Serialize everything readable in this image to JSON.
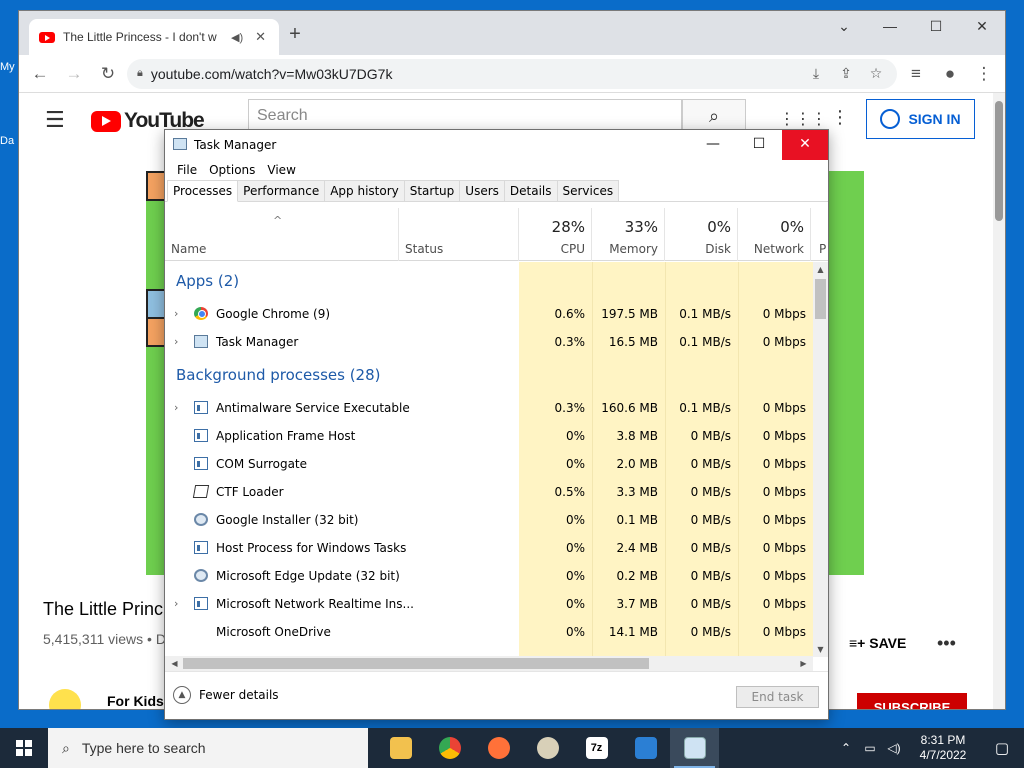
{
  "desktop": {
    "label1": "My",
    "label2": "Da"
  },
  "browser": {
    "tab_title": "The Little Princess - I don't w",
    "url": "youtube.com/watch?v=Mw03kU7DG7k",
    "window_controls": [
      "⌄",
      "—",
      "☐",
      "✕"
    ]
  },
  "youtube": {
    "search_placeholder": "Search",
    "sign_in": "SIGN IN",
    "video_title": "The Little Princ",
    "views": "5,415,311 views • D",
    "save": "SAVE",
    "channel": "For Kids T",
    "subscribe": "SUBSCRIBE"
  },
  "taskmanager": {
    "title": "Task Manager",
    "menu": [
      "File",
      "Options",
      "View"
    ],
    "tabs": [
      "Processes",
      "Performance",
      "App history",
      "Startup",
      "Users",
      "Details",
      "Services"
    ],
    "columns": {
      "name": "Name",
      "status": "Status",
      "cpu": {
        "pct": "28%",
        "label": "CPU"
      },
      "memory": {
        "pct": "33%",
        "label": "Memory"
      },
      "disk": {
        "pct": "0%",
        "label": "Disk"
      },
      "network": {
        "pct": "0%",
        "label": "Network"
      },
      "power": "P"
    },
    "groups": {
      "apps": "Apps (2)",
      "background": "Background processes (28)"
    },
    "apps": [
      {
        "name": "Google Chrome (9)",
        "icon": "chrome-icon",
        "cpu": "0.6%",
        "mem": "197.5 MB",
        "disk": "0.1 MB/s",
        "net": "0 Mbps"
      },
      {
        "name": "Task Manager",
        "icon": "task-manager-icon",
        "cpu": "0.3%",
        "mem": "16.5 MB",
        "disk": "0.1 MB/s",
        "net": "0 Mbps"
      }
    ],
    "background": [
      {
        "name": "Antimalware Service Executable",
        "icon": "window-icon",
        "cpu": "0.3%",
        "mem": "160.6 MB",
        "disk": "0.1 MB/s",
        "net": "0 Mbps"
      },
      {
        "name": "Application Frame Host",
        "icon": "window-icon",
        "cpu": "0%",
        "mem": "3.8 MB",
        "disk": "0 MB/s",
        "net": "0 Mbps"
      },
      {
        "name": "COM Surrogate",
        "icon": "window-icon",
        "cpu": "0%",
        "mem": "2.0 MB",
        "disk": "0 MB/s",
        "net": "0 Mbps"
      },
      {
        "name": "CTF Loader",
        "icon": "pen-icon",
        "cpu": "0.5%",
        "mem": "3.3 MB",
        "disk": "0 MB/s",
        "net": "0 Mbps"
      },
      {
        "name": "Google Installer (32 bit)",
        "icon": "installer-icon",
        "cpu": "0%",
        "mem": "0.1 MB",
        "disk": "0 MB/s",
        "net": "0 Mbps"
      },
      {
        "name": "Host Process for Windows Tasks",
        "icon": "window-icon",
        "cpu": "0%",
        "mem": "2.4 MB",
        "disk": "0 MB/s",
        "net": "0 Mbps"
      },
      {
        "name": "Microsoft Edge Update (32 bit)",
        "icon": "installer-icon",
        "cpu": "0%",
        "mem": "0.2 MB",
        "disk": "0 MB/s",
        "net": "0 Mbps"
      },
      {
        "name": "Microsoft Network Realtime Ins...",
        "icon": "window-icon",
        "cpu": "0%",
        "mem": "3.7 MB",
        "disk": "0 MB/s",
        "net": "0 Mbps"
      },
      {
        "name": "Microsoft OneDrive",
        "icon": "none",
        "cpu": "0%",
        "mem": "14.1 MB",
        "disk": "0 MB/s",
        "net": "0 Mbps"
      }
    ],
    "fewer_details": "Fewer details",
    "end_task": "End task"
  },
  "taskbar": {
    "search_placeholder": "Type here to search",
    "apps": [
      "file-explorer-icon",
      "chrome-icon",
      "firefox-icon",
      "paint-icon",
      "7zip-icon",
      "app-icon",
      "task-manager-icon"
    ],
    "time": "8:31 PM",
    "date": "4/7/2022"
  }
}
